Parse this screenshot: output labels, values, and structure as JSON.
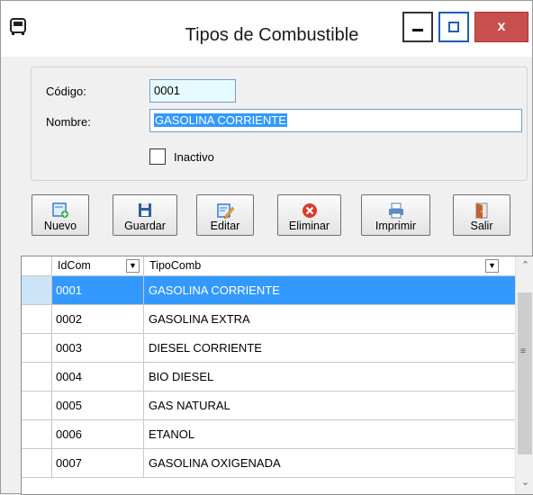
{
  "window": {
    "title": "Tipos de Combustible",
    "close_glyph": "x"
  },
  "form": {
    "codigo_label": "Código:",
    "codigo_value": "0001",
    "nombre_label": "Nombre:",
    "nombre_value": "GASOLINA CORRIENTE",
    "inactivo_label": "Inactivo",
    "inactivo_checked": false
  },
  "toolbar": {
    "nuevo": "Nuevo",
    "guardar": "Guardar",
    "editar": "Editar",
    "eliminar": "Eliminar",
    "imprimir": "Imprimir",
    "salir": "Salir"
  },
  "grid": {
    "columns": [
      "IdCom",
      "TipoComb"
    ],
    "rows": [
      {
        "id": "0001",
        "tipo": "GASOLINA CORRIENTE"
      },
      {
        "id": "0002",
        "tipo": "GASOLINA EXTRA"
      },
      {
        "id": "0003",
        "tipo": "DIESEL CORRIENTE"
      },
      {
        "id": "0004",
        "tipo": "BIO DIESEL"
      },
      {
        "id": "0005",
        "tipo": "GAS NATURAL"
      },
      {
        "id": "0006",
        "tipo": "ETANOL"
      },
      {
        "id": "0007",
        "tipo": "GASOLINA OXIGENADA"
      }
    ],
    "selected_index": 0
  },
  "colors": {
    "selection": "#3399ff",
    "close_button": "#c7504f",
    "accent_border": "#1a5fb4"
  }
}
